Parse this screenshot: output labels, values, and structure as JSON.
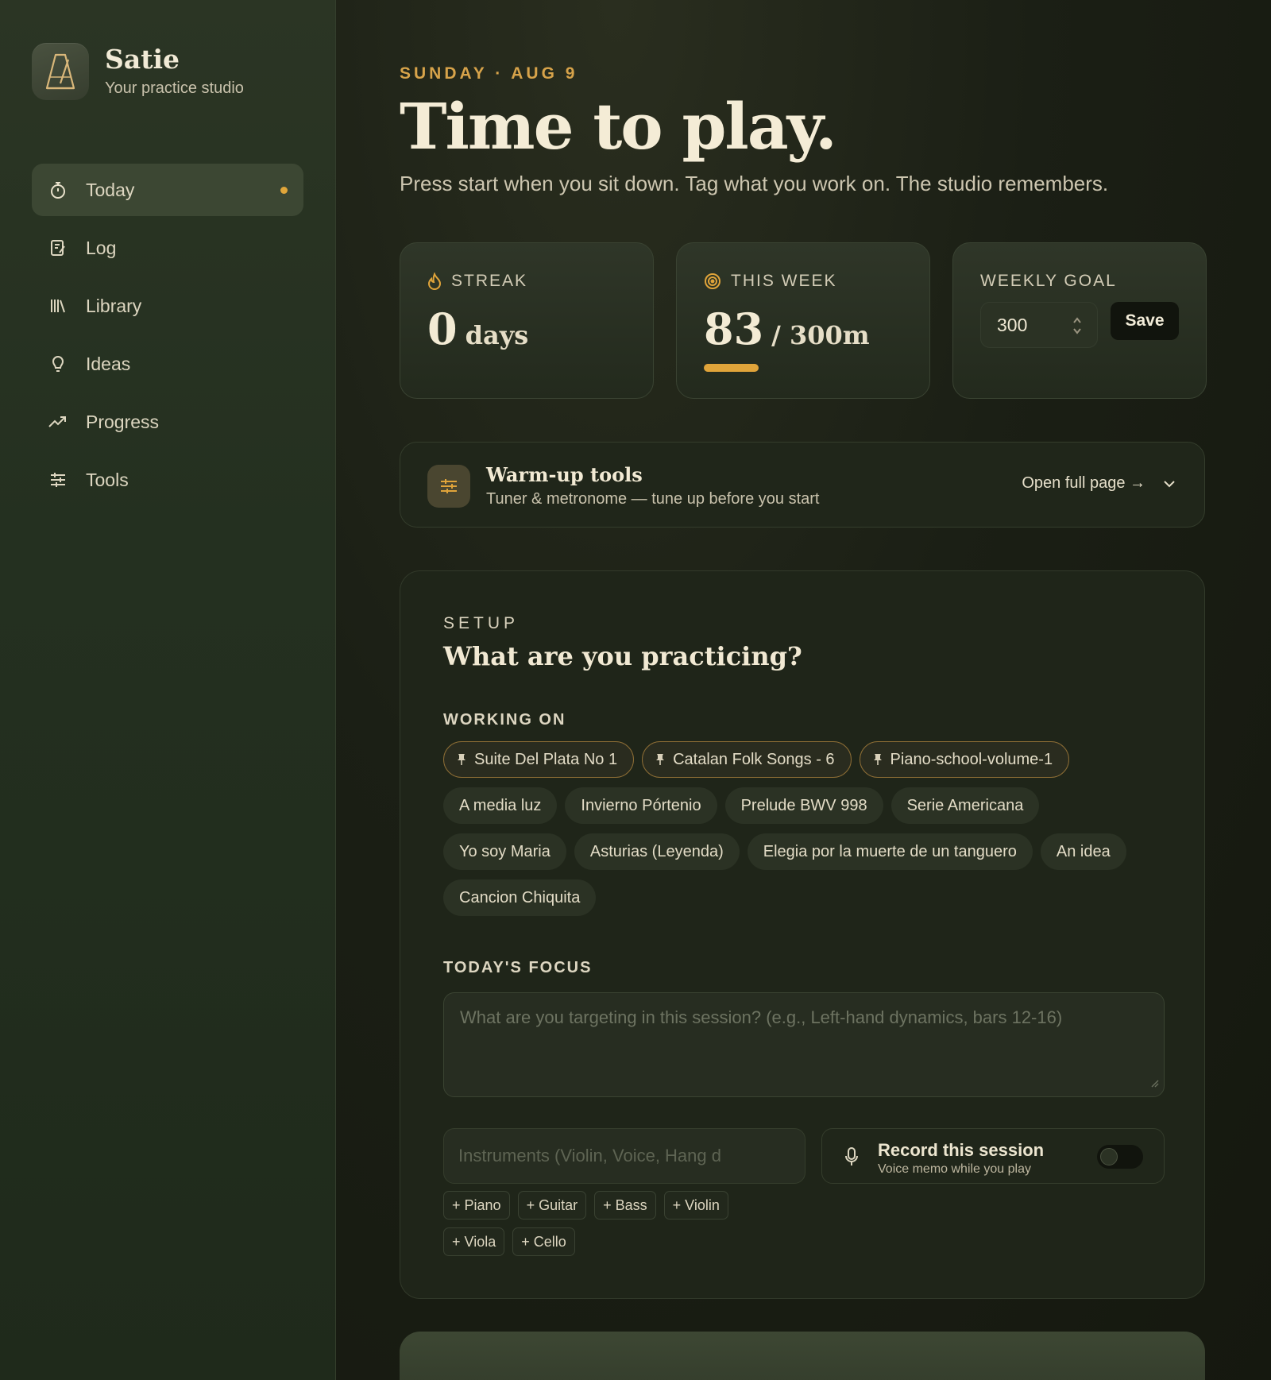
{
  "brand": {
    "name": "Satie",
    "tagline": "Your practice studio"
  },
  "nav": [
    {
      "label": "Today",
      "icon": "stopwatch-icon",
      "active": true
    },
    {
      "label": "Log",
      "icon": "journal-icon"
    },
    {
      "label": "Library",
      "icon": "library-icon"
    },
    {
      "label": "Ideas",
      "icon": "lightbulb-icon"
    },
    {
      "label": "Progress",
      "icon": "trend-icon"
    },
    {
      "label": "Tools",
      "icon": "sliders-icon"
    }
  ],
  "header": {
    "date": "SUNDAY · AUG 9",
    "title": "Time to play.",
    "subtitle": "Press start when you sit down. Tag what you work on. The studio remembers."
  },
  "stats": {
    "streak": {
      "label": "STREAK",
      "value": "0",
      "unit": "days"
    },
    "week": {
      "label": "THIS WEEK",
      "value": "83",
      "unit": "/ 300m",
      "progress": 0.277
    },
    "goal": {
      "label": "WEEKLY GOAL",
      "value": "300",
      "save_label": "Save"
    }
  },
  "warmup": {
    "title": "Warm-up tools",
    "subtitle": "Tuner & metronome — tune up before you start",
    "link": "Open full page →"
  },
  "setup": {
    "kicker": "SETUP",
    "title": "What are you practicing?",
    "working_on_label": "WORKING ON",
    "pinned": [
      "Suite Del Plata No 1",
      "Catalan Folk Songs - 6",
      "Piano-school-volume-1"
    ],
    "pieces": [
      "A media luz",
      "Invierno Pórtenio",
      "Prelude BWV 998",
      "Serie Americana",
      "Yo soy Maria",
      "Asturias (Leyenda)",
      "Elegia por la muerte de un tanguero",
      "An idea",
      "Cancion Chiquita"
    ],
    "focus_label": "TODAY'S FOCUS",
    "focus_placeholder": "What are you targeting in this session? (e.g., Left-hand dynamics, bars 12-16)",
    "instruments_placeholder": "Instruments (Violin, Voice, Hang d",
    "quick_instruments": [
      "+ Piano",
      "+ Guitar",
      "+ Bass",
      "+ Violin",
      "+ Viola",
      "+ Cello"
    ],
    "record_title": "Record this session",
    "record_sub": "Voice memo while you play",
    "record_enabled": false
  },
  "colors": {
    "accent": "#e0a43a",
    "background": "#161a12",
    "sidebar": "#243020"
  }
}
